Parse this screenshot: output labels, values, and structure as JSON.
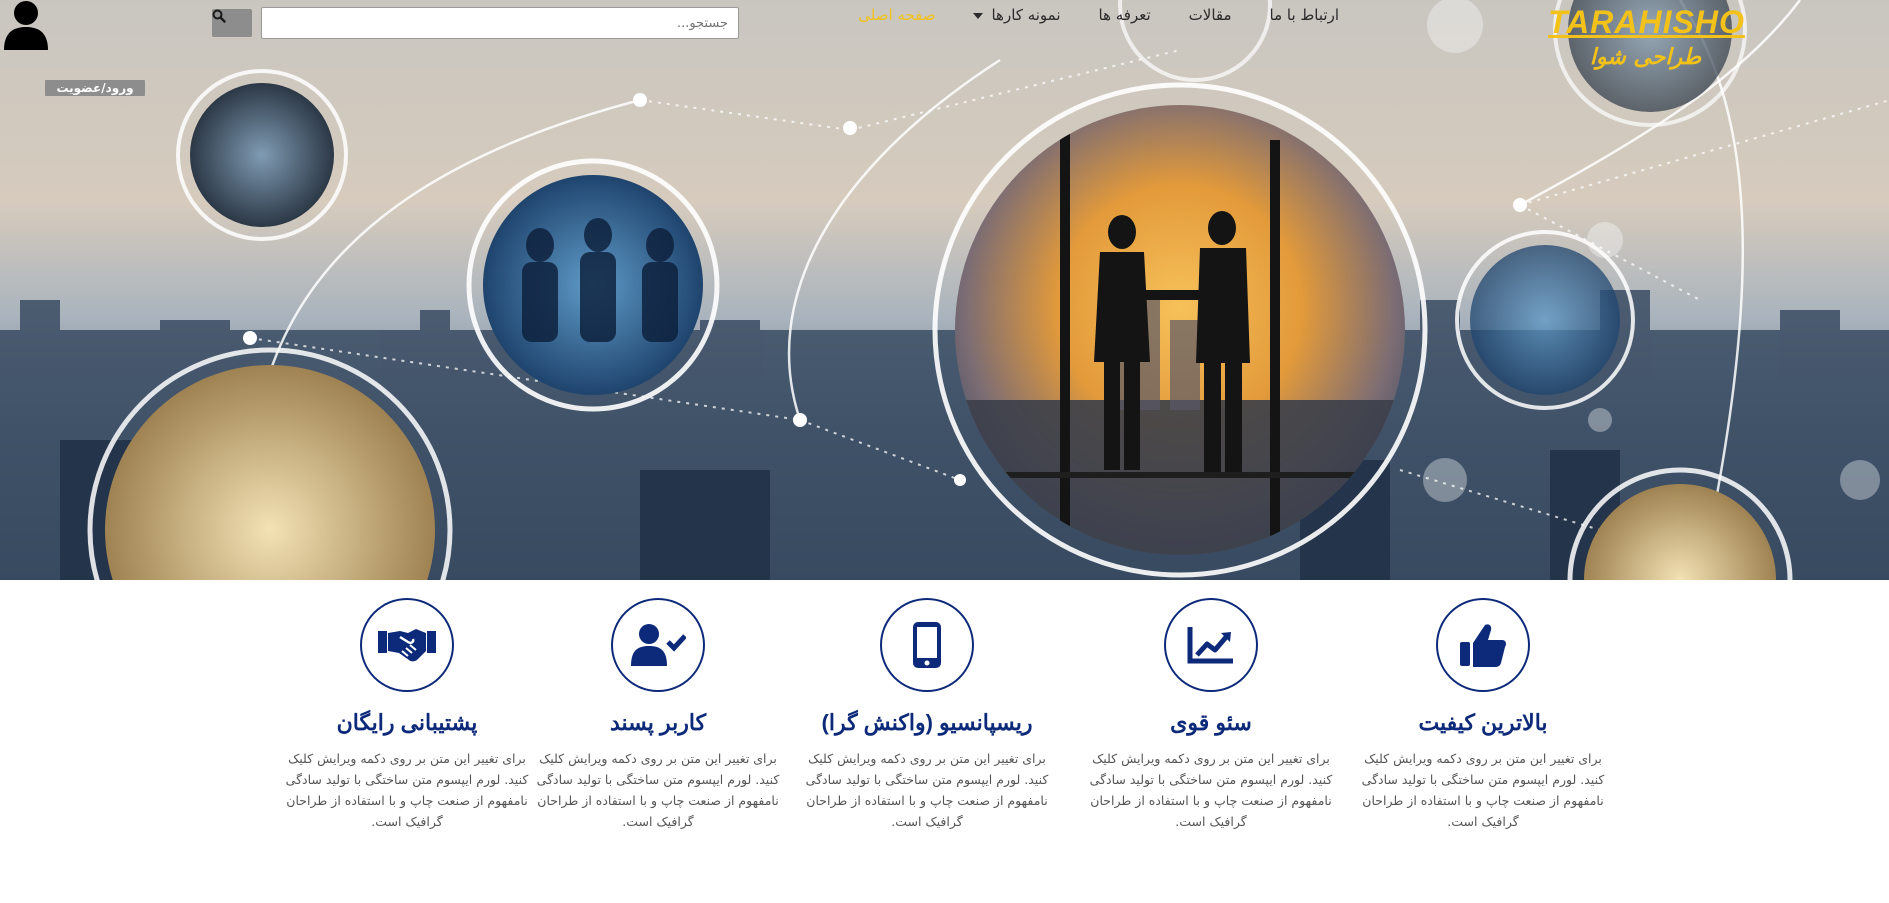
{
  "header": {
    "logo_en": "TARAHISHO",
    "logo_fa": "طراحی شوا",
    "nav": [
      {
        "label": "صفحه اصلی",
        "active": true
      },
      {
        "label": "نمونه کارها"
      },
      {
        "label": "تعرفه ها"
      },
      {
        "label": "مقالات"
      },
      {
        "label": "ارتباط با ما"
      }
    ],
    "search_placeholder": "جستجو...",
    "login_label": "ورود/عضویت"
  },
  "features": [
    {
      "title": "بالاترین کیفیت",
      "icon": "thumbs-up-icon",
      "text": "برای تغییر این متن بر روی دکمه ویرایش کلیک کنید. لورم ایپسوم متن ساختگی با تولید سادگی نامفهوم از صنعت چاپ و با استفاده از طراحان گرافیک است."
    },
    {
      "title": "سئو قوی",
      "icon": "chart-line-icon",
      "text": "برای تغییر این متن بر روی دکمه ویرایش کلیک کنید. لورم ایپسوم متن ساختگی با تولید سادگی نامفهوم از صنعت چاپ و با استفاده از طراحان گرافیک است."
    },
    {
      "title": "ریسپانسیو (واکنش گرا)",
      "icon": "mobile-icon",
      "text": "برای تغییر این متن بر روی دکمه ویرایش کلیک کنید. لورم ایپسوم متن ساختگی با تولید سادگی نامفهوم از صنعت چاپ و با استفاده از طراحان گرافیک است."
    },
    {
      "title": "کاربر پسند",
      "icon": "user-check-icon",
      "text": "برای تغییر این متن بر روی دکمه ویرایش کلیک کنید. لورم ایپسوم متن ساختگی با تولید سادگی نامفهوم از صنعت چاپ و با استفاده از طراحان گرافیک است."
    },
    {
      "title": "پشتیبانی رایگان",
      "icon": "handshake-icon",
      "text": "برای تغییر این متن بر روی دکمه ویرایش کلیک کنید. لورم ایپسوم متن ساختگی با تولید سادگی نامفهوم از صنعت چاپ و با استفاده از طراحان گرافیک است."
    }
  ],
  "colors": {
    "accent": "#f2c21a",
    "brand": "#0d2a7a",
    "button": "#8d8d8d"
  }
}
